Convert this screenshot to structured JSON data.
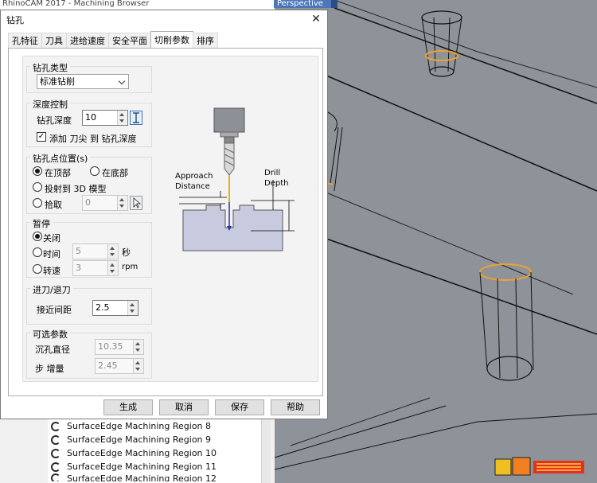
{
  "background": {
    "window_title": "RhinoCAM 2017 - Machining Browser",
    "viewport_tab": "Perspective",
    "browser_items": [
      "SurfaceEdge Machining Region 8",
      "SurfaceEdge Machining Region 9",
      "SurfaceEdge Machining Region 10",
      "SurfaceEdge Machining Region 11",
      "SurfaceEdge Machining Region 12"
    ]
  },
  "dialog": {
    "title": "钻孔",
    "close_glyph": "✕",
    "tabs": [
      "孔特征",
      "刀具",
      "进给速度",
      "安全平面",
      "切削参数",
      "排序"
    ],
    "active_tab": "切削参数"
  },
  "drill_type": {
    "title": "钻孔类型",
    "selected": "标准钻削"
  },
  "depth": {
    "title": "深度控制",
    "depth_label": "钻孔深度",
    "depth_value": "10",
    "add_tip_label": "添加 刀尖 到 钻孔深度",
    "add_tip_checked": true
  },
  "position": {
    "title": "钻孔点位置(s)",
    "at_top": "在顶部",
    "at_bottom": "在底部",
    "project": "投射到 3D 模型",
    "pick": "拾取",
    "pick_value": "0",
    "selected": "at_top"
  },
  "dwell": {
    "title": "暂停",
    "off": "关闭",
    "time": "时间",
    "time_value": "5",
    "time_unit": "秒",
    "revs": "转速",
    "revs_value": "3",
    "revs_unit": "rpm",
    "selected": "off"
  },
  "approach": {
    "title": "进刀/退刀",
    "distance_label": "接近间距",
    "distance_value": "2.5"
  },
  "optional": {
    "title": "可选参数",
    "counterbore_label": "沉孔直径",
    "counterbore_value": "10.35",
    "step_label": "步 增量",
    "step_value": "2.45"
  },
  "diagram": {
    "approach_label_1": "Approach",
    "approach_label_2": "Distance",
    "drill_label_1": "Drill",
    "drill_label_2": "Depth"
  },
  "buttons": {
    "generate": "生成",
    "cancel": "取消",
    "save": "保存",
    "help": "帮助"
  },
  "colors": {
    "viewport_bg": "#8d9299",
    "highlight_orange": "#f0a030",
    "accent_blue": "#0078d7"
  }
}
